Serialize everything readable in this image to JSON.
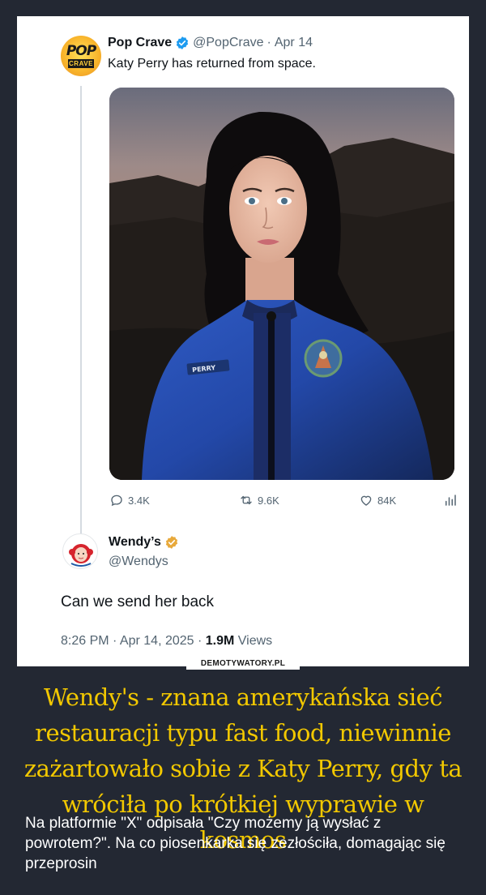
{
  "tweet": {
    "author_name": "Pop Crave",
    "author_handle": "@PopCrave",
    "separator": "·",
    "date": "Apr 14",
    "text": "Katy Perry has returned from space.",
    "avatar_text_top": "POP",
    "avatar_text_bottom": "CRAVE",
    "suit_nametag": "PERRY",
    "stats": {
      "replies": "3.4K",
      "reposts": "9.6K",
      "likes": "84K"
    },
    "icons": [
      "reply-icon",
      "repost-icon",
      "like-icon",
      "analytics-icon",
      "verified-badge-icon"
    ]
  },
  "reply": {
    "author_name": "Wendy’s",
    "author_handle": "@Wendys",
    "text": "Can we send her back",
    "time": "8:26 PM · Apr 14, 2025 · ",
    "views_count": "1.9M",
    "views_label": " Views"
  },
  "watermark": "DEMOTYWATORY.PL",
  "caption": {
    "headline": "Wendy's - znana amerykańska sieć restauracji typu fast food, niewinnie zażartowało sobie z Katy Perry, gdy ta wróciła po krótkiej wyprawie w kosmos",
    "description": "Na platformie \"X\" odpisała \"Czy możemy ją wysłać z powrotem?\". Na co piosenkarka się zezłościła, domagając się przeprosin"
  },
  "colors": {
    "page_background": "#232833",
    "headline": "#f2c800",
    "verified_blue": "#1d9bf0",
    "verified_gold": "#e8a93b",
    "muted_text": "#536471"
  }
}
